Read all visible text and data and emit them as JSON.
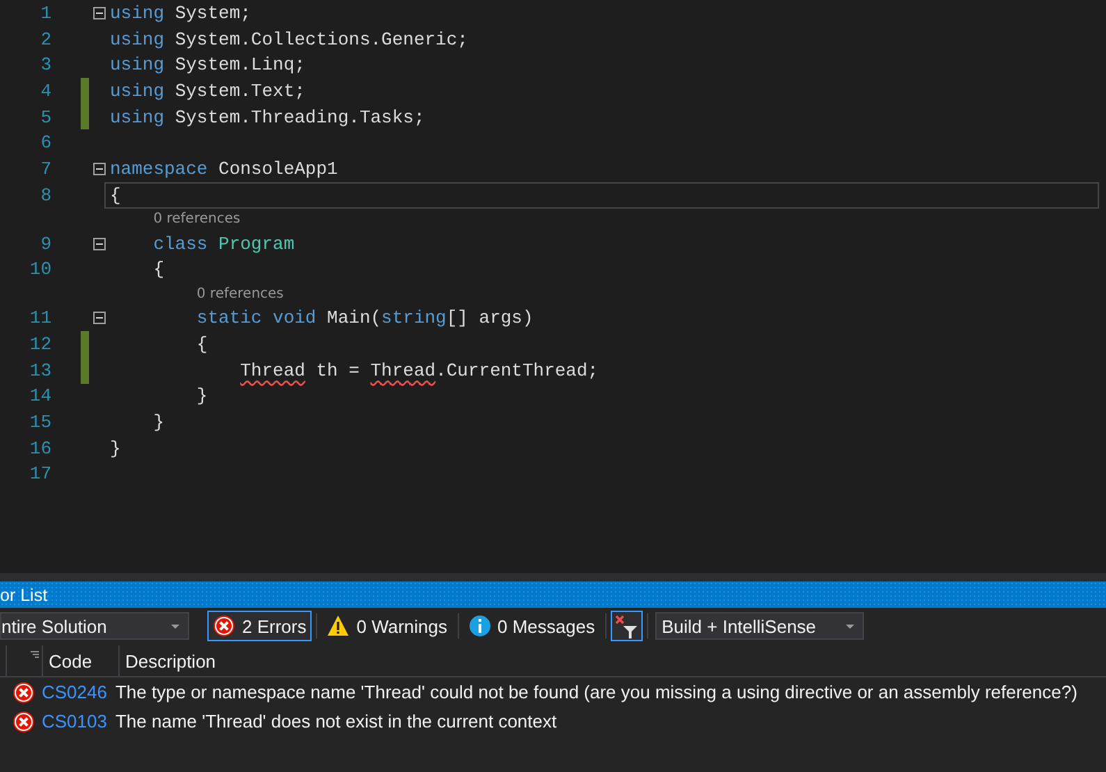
{
  "editor": {
    "lines": [
      {
        "number": "1",
        "tokens": [
          {
            "text": "using",
            "kind": "keyword"
          },
          {
            "text": " System;",
            "kind": "plain"
          }
        ],
        "changed": false,
        "foldable": true,
        "current": false
      },
      {
        "number": "2",
        "tokens": [
          {
            "text": "using",
            "kind": "keyword"
          },
          {
            "text": " System.Collections.Generic;",
            "kind": "plain"
          }
        ],
        "changed": false,
        "foldable": false,
        "current": false
      },
      {
        "number": "3",
        "tokens": [
          {
            "text": "using",
            "kind": "keyword"
          },
          {
            "text": " System.Linq;",
            "kind": "plain"
          }
        ],
        "changed": false,
        "foldable": false,
        "current": false
      },
      {
        "number": "4",
        "tokens": [
          {
            "text": "using",
            "kind": "keyword"
          },
          {
            "text": " System.Text;",
            "kind": "plain"
          }
        ],
        "changed": true,
        "foldable": false,
        "current": false
      },
      {
        "number": "5",
        "tokens": [
          {
            "text": "using",
            "kind": "keyword"
          },
          {
            "text": " System.Threading.Tasks;",
            "kind": "plain"
          }
        ],
        "changed": true,
        "foldable": false,
        "current": false
      },
      {
        "number": "6",
        "changed": false,
        "foldable": false,
        "current": false
      },
      {
        "number": "7",
        "tokens": [
          {
            "text": "namespace",
            "kind": "keyword"
          },
          {
            "text": " ConsoleApp1",
            "kind": "plain"
          }
        ],
        "changed": false,
        "foldable": true,
        "current": false
      },
      {
        "number": "8",
        "tokens": [
          {
            "text": "{",
            "kind": "plain"
          }
        ],
        "changed": false,
        "foldable": false,
        "current": true
      },
      {
        "number": "9",
        "lens": "0 references",
        "tokens": [
          {
            "text": "    class",
            "kind": "keyword"
          },
          {
            "text": " Program",
            "kind": "type"
          }
        ],
        "changed": false,
        "foldable": true,
        "current": false
      },
      {
        "number": "10",
        "tokens": [
          {
            "text": "    {",
            "kind": "plain"
          }
        ],
        "changed": false,
        "foldable": false,
        "current": false
      },
      {
        "number": "11",
        "lens": "0 references",
        "tokens": [
          {
            "text": "        static void",
            "kind": "keyword"
          },
          {
            "text": " Main(",
            "kind": "plain"
          },
          {
            "text": "string",
            "kind": "keyword"
          },
          {
            "text": "[] args)",
            "kind": "plain"
          }
        ],
        "changed": false,
        "foldable": true,
        "current": false
      },
      {
        "number": "12",
        "tokens": [
          {
            "text": "        {",
            "kind": "plain"
          }
        ],
        "changed": true,
        "foldable": false,
        "current": false
      },
      {
        "number": "13",
        "tokens": [
          {
            "text": "            Thread",
            "kind": "error"
          },
          {
            "text": " th = ",
            "kind": "plain"
          },
          {
            "text": "Thread",
            "kind": "error"
          },
          {
            "text": ".CurrentThread;",
            "kind": "plain"
          }
        ],
        "changed": true,
        "foldable": false,
        "current": false
      },
      {
        "number": "14",
        "tokens": [
          {
            "text": "        }",
            "kind": "plain"
          }
        ],
        "changed": false,
        "foldable": false,
        "current": false
      },
      {
        "number": "15",
        "tokens": [
          {
            "text": "    }",
            "kind": "plain"
          }
        ],
        "changed": false,
        "foldable": false,
        "current": false
      },
      {
        "number": "16",
        "tokens": [
          {
            "text": "}",
            "kind": "plain"
          }
        ],
        "changed": false,
        "foldable": false,
        "current": false
      },
      {
        "number": "17",
        "changed": false,
        "foldable": false,
        "current": false
      }
    ]
  },
  "error_list": {
    "title": "or List",
    "scope": "ntire Solution",
    "filters": [
      {
        "kind": "error",
        "label": "2 Errors",
        "selected": true
      },
      {
        "kind": "warning",
        "label": "0 Warnings",
        "selected": false
      },
      {
        "kind": "info",
        "label": "0 Messages",
        "selected": false
      }
    ],
    "filter_toggle": {
      "selected": true
    },
    "source": "Build + IntelliSense",
    "columns": [
      "Code",
      "Description"
    ],
    "rows": [
      {
        "code": "CS0246",
        "description": "The type or namespace name 'Thread' could not be found (are you missing a using directive or an assembly reference?)"
      },
      {
        "code": "CS0103",
        "description": "The name 'Thread' does not exist in the current context"
      }
    ]
  }
}
